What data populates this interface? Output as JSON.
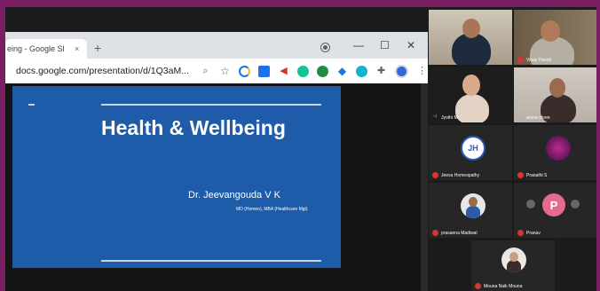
{
  "browser": {
    "tab_title": "eing - Google Sl",
    "tab_close": "×",
    "new_tab": "+",
    "url": "docs.google.com/presentation/d/1Q3aM...",
    "min": "—",
    "max": "☐",
    "close": "✕"
  },
  "slide": {
    "title": "Health & Wellbeing",
    "author": "Dr. Jeevangouda V K",
    "credentials": "MD (Homeo), MBA (Healthcare Mgt)"
  },
  "participants": [
    {
      "name": "",
      "muted": false
    },
    {
      "name": "Vinay Pandit",
      "muted": true
    },
    {
      "name": "Jyothi M",
      "muted": false
    },
    {
      "name": "aruna shree",
      "muted": false
    },
    {
      "name": "Jeeva Homeopathy",
      "muted": true,
      "avatar": "JH"
    },
    {
      "name": "Pranathi S",
      "muted": true
    },
    {
      "name": "prasanna Madiwal",
      "muted": true
    },
    {
      "name": "Pranav",
      "muted": true,
      "avatar": "P"
    },
    {
      "name": "Mouna Naik Mouna",
      "muted": true
    }
  ]
}
